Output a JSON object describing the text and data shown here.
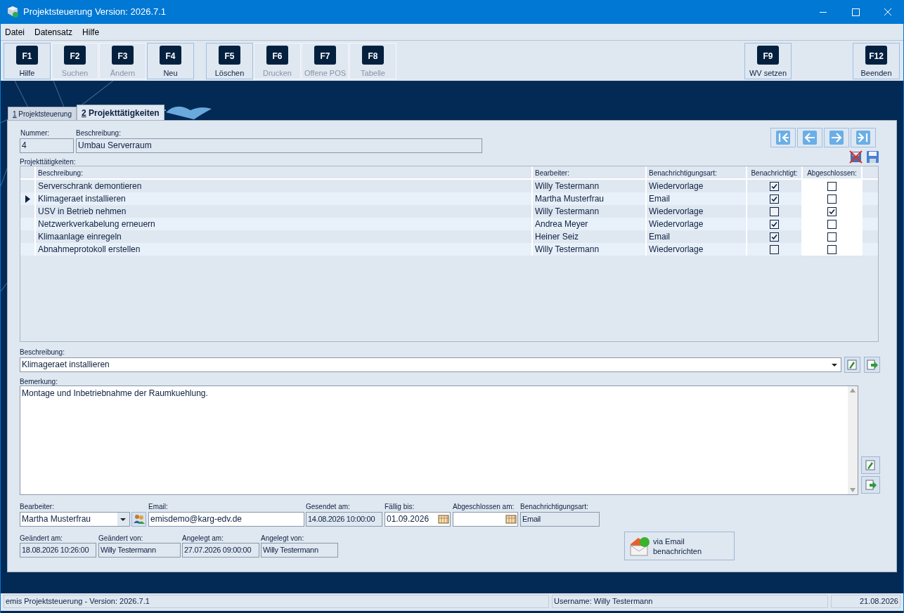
{
  "window": {
    "title": "Projektsteuerung Version: 2026.7.1"
  },
  "menu": [
    {
      "label": "Datei"
    },
    {
      "label": "Datensatz"
    },
    {
      "label": "Hilfe"
    }
  ],
  "toolbar": [
    {
      "key": "F1",
      "label": "Hilfe",
      "disabled": false
    },
    {
      "key": "F2",
      "label": "Suchen",
      "disabled": true
    },
    {
      "key": "F3",
      "label": "Ändern",
      "disabled": true
    },
    {
      "key": "F4",
      "label": "Neu",
      "disabled": false
    },
    {
      "key": "F5",
      "label": "Löschen",
      "disabled": false
    },
    {
      "key": "F6",
      "label": "Drucken",
      "disabled": true
    },
    {
      "key": "F7",
      "label": "Offene POS",
      "disabled": true
    },
    {
      "key": "F8",
      "label": "Tabelle",
      "disabled": true
    },
    {
      "key": "F9",
      "label": "WV setzen",
      "disabled": false
    },
    {
      "key": "F12",
      "label": "Beenden",
      "disabled": false
    }
  ],
  "tabs": [
    {
      "num": "1",
      "label": " Projektsteuerung",
      "selected": false
    },
    {
      "num": "2",
      "label": " Projekttätigkeiten",
      "selected": true
    }
  ],
  "header": {
    "nummer_label": "Nummer:",
    "nummer": "4",
    "beschreibung_label": "Beschreibung:",
    "beschreibung": "Umbau Serverraum"
  },
  "table": {
    "label": "Projekttätigkeiten:",
    "columns": [
      "Beschreibung:",
      "Bearbeiter:",
      "Benachrichtigungsart:",
      "Benachrichtigt:",
      "Abgeschlossen:"
    ],
    "rows": [
      {
        "beschreibung": "Serverschrank demontieren",
        "bearbeiter": "Willy Testermann",
        "art": "Wiedervorlage",
        "benachrichtigt": true,
        "abgeschlossen": false,
        "selected": false
      },
      {
        "beschreibung": "Klimageraet installieren",
        "bearbeiter": "Martha Musterfrau",
        "art": "Email",
        "benachrichtigt": true,
        "abgeschlossen": false,
        "selected": true
      },
      {
        "beschreibung": "USV in Betrieb nehmen",
        "bearbeiter": "Willy Testermann",
        "art": "Wiedervorlage",
        "benachrichtigt": false,
        "abgeschlossen": true,
        "selected": false
      },
      {
        "beschreibung": "Netzwerkverkabelung erneuern",
        "bearbeiter": "Andrea Meyer",
        "art": "Wiedervorlage",
        "benachrichtigt": true,
        "abgeschlossen": false,
        "selected": false
      },
      {
        "beschreibung": "Klimaanlage einregeln",
        "bearbeiter": "Heiner Seiz",
        "art": "Email",
        "benachrichtigt": true,
        "abgeschlossen": false,
        "selected": false
      },
      {
        "beschreibung": "Abnahmeprotokoll erstellen",
        "bearbeiter": "Willy Testermann",
        "art": "Wiedervorlage",
        "benachrichtigt": false,
        "abgeschlossen": false,
        "selected": false
      }
    ]
  },
  "detail": {
    "beschreibung_label": "Beschreibung:",
    "beschreibung": "Klimageraet installieren",
    "bemerkung_label": "Bemerkung:",
    "bemerkung": "Montage und Inbetriebnahme der Raumkuehlung."
  },
  "fields_row1": [
    {
      "label": "Bearbeiter:",
      "value": "Martha Musterfrau",
      "kind": "combo"
    },
    {
      "label": "Email:",
      "value": "emisdemo@karg-edv.de",
      "kind": "input"
    },
    {
      "label": "Gesendet am:",
      "value": "14.08.2026 10:00:00",
      "kind": "readonly"
    },
    {
      "label": "Fällig bis:",
      "value": "01.09.2026",
      "kind": "date"
    },
    {
      "label": "Abgeschlossen am:",
      "kind": "date"
    },
    {
      "label": "Benachrichtigungsart:",
      "value": "Email",
      "kind": "readonly"
    }
  ],
  "fields_row2": [
    {
      "label": "Geändert am:",
      "value": "18.08.2026 10:26:00"
    },
    {
      "label": "Geändert von:",
      "value": "Willy Testermann"
    },
    {
      "label": "Angelegt am:",
      "value": "27.07.2026 09:00:00"
    },
    {
      "label": "Angelegt von:",
      "value": "Willy Testermann"
    }
  ],
  "email_button": {
    "label": "via Email benachrichten"
  },
  "status_bar": [
    "emis Projektsteuerung - Version: 2026.7.1",
    "Username: Willy Testermann",
    "21.08.2026"
  ]
}
